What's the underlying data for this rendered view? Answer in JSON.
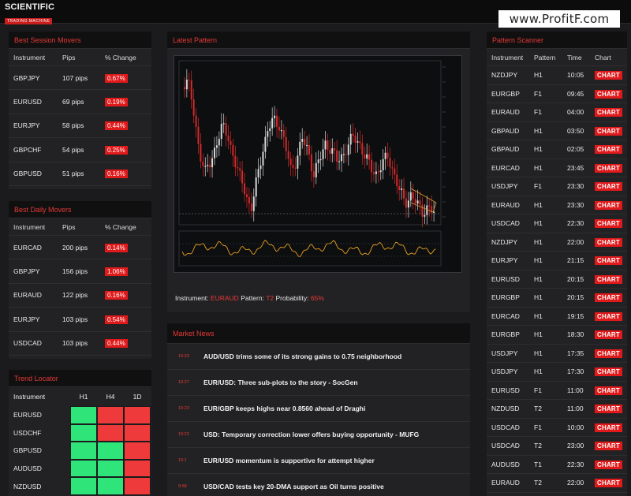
{
  "brand": {
    "line1": "SCIENTIFIC",
    "line2": "TRADING MACHINE"
  },
  "watermark": "www.ProfitF.com",
  "session_movers": {
    "title": "Best Session Movers",
    "headers": [
      "Instrument",
      "Pips",
      "% Change"
    ],
    "rows": [
      {
        "instrument": "GBPJPY",
        "pips": "107 pips",
        "change": "0.67%"
      },
      {
        "instrument": "EURUSD",
        "pips": "69 pips",
        "change": "0.19%"
      },
      {
        "instrument": "EURJPY",
        "pips": "58 pips",
        "change": "0.44%"
      },
      {
        "instrument": "GBPCHF",
        "pips": "54 pips",
        "change": "0.25%"
      },
      {
        "instrument": "GBPUSD",
        "pips": "51 pips",
        "change": "0.16%"
      }
    ]
  },
  "daily_movers": {
    "title": "Best Daily Movers",
    "headers": [
      "Instrument",
      "Pips",
      "% Change"
    ],
    "rows": [
      {
        "instrument": "EURCAD",
        "pips": "200 pips",
        "change": "0.14%"
      },
      {
        "instrument": "GBPJPY",
        "pips": "156 pips",
        "change": "1.06%"
      },
      {
        "instrument": "EURAUD",
        "pips": "122 pips",
        "change": "0.16%"
      },
      {
        "instrument": "EURJPY",
        "pips": "103 pips",
        "change": "0.54%"
      },
      {
        "instrument": "USDCAD",
        "pips": "103 pips",
        "change": "0.44%"
      }
    ]
  },
  "trend_locator": {
    "title": "Trend Locator",
    "headers": [
      "Instrument",
      "H1",
      "H4",
      "1D"
    ],
    "colors": {
      "green": "#2fe57a",
      "red": "#ee3a3a"
    },
    "rows": [
      {
        "instrument": "EURUSD",
        "h1": "green",
        "h4": "red",
        "d1": "red"
      },
      {
        "instrument": "USDCHF",
        "h1": "green",
        "h4": "red",
        "d1": "red"
      },
      {
        "instrument": "GBPUSD",
        "h1": "green",
        "h4": "green",
        "d1": "red"
      },
      {
        "instrument": "AUDUSD",
        "h1": "green",
        "h4": "green",
        "d1": "red"
      },
      {
        "instrument": "NZDUSD",
        "h1": "green",
        "h4": "green",
        "d1": "red"
      }
    ]
  },
  "latest_pattern": {
    "title": "Latest Pattern",
    "caption": {
      "instrument_label": "Instrument:",
      "instrument": "EURAUD",
      "pattern_label": "Pattern:",
      "pattern": "T2",
      "probability_label": "Probability:",
      "probability": "65%"
    }
  },
  "market_news": {
    "title": "Market News",
    "items": [
      {
        "time": "10:33",
        "title": "AUD/USD trims some of its strong gains to 0.75 neighborhood"
      },
      {
        "time": "10:27",
        "title": "EUR/USD: Three sub-plots to the story - SocGen"
      },
      {
        "time": "10:23",
        "title": "EUR/GBP keeps highs near 0.8560 ahead of Draghi"
      },
      {
        "time": "10:22",
        "title": "USD: Temporary correction lower offers buying opportunity - MUFG"
      },
      {
        "time": "10:1",
        "title": "EUR/USD momentum is supportive for attempt higher"
      },
      {
        "time": "9:58",
        "title": "USD/CAD tests key 20-DMA support as Oil turns positive"
      }
    ]
  },
  "pattern_scanner": {
    "title": "Pattern Scanner",
    "headers": [
      "Instrument",
      "Pattern",
      "Time",
      "Chart"
    ],
    "button_label": "CHART",
    "rows": [
      {
        "instrument": "NZDJPY",
        "pattern": "H1",
        "time": "10:05"
      },
      {
        "instrument": "EURGBP",
        "pattern": "F1",
        "time": "09:45"
      },
      {
        "instrument": "EURAUD",
        "pattern": "F1",
        "time": "04:00"
      },
      {
        "instrument": "GBPAUD",
        "pattern": "H1",
        "time": "03:50"
      },
      {
        "instrument": "GBPAUD",
        "pattern": "H1",
        "time": "02:05"
      },
      {
        "instrument": "EURCAD",
        "pattern": "H1",
        "time": "23:45"
      },
      {
        "instrument": "USDJPY",
        "pattern": "F1",
        "time": "23:30"
      },
      {
        "instrument": "EURAUD",
        "pattern": "H1",
        "time": "23:30"
      },
      {
        "instrument": "USDCAD",
        "pattern": "H1",
        "time": "22:30"
      },
      {
        "instrument": "NZDJPY",
        "pattern": "H1",
        "time": "22:00"
      },
      {
        "instrument": "EURJPY",
        "pattern": "H1",
        "time": "21:15"
      },
      {
        "instrument": "EURUSD",
        "pattern": "H1",
        "time": "20:15"
      },
      {
        "instrument": "EURGBP",
        "pattern": "H1",
        "time": "20:15"
      },
      {
        "instrument": "EURCAD",
        "pattern": "H1",
        "time": "19:15"
      },
      {
        "instrument": "EURGBP",
        "pattern": "H1",
        "time": "18:30"
      },
      {
        "instrument": "USDJPY",
        "pattern": "H1",
        "time": "17:35"
      },
      {
        "instrument": "USDJPY",
        "pattern": "H1",
        "time": "17:30"
      },
      {
        "instrument": "EURUSD",
        "pattern": "F1",
        "time": "11:00"
      },
      {
        "instrument": "NZDUSD",
        "pattern": "T2",
        "time": "11:00"
      },
      {
        "instrument": "USDCAD",
        "pattern": "F1",
        "time": "10:00"
      },
      {
        "instrument": "USDCAD",
        "pattern": "T2",
        "time": "23:00"
      },
      {
        "instrument": "AUDUSD",
        "pattern": "T1",
        "time": "22:30"
      },
      {
        "instrument": "EURAUD",
        "pattern": "T2",
        "time": "22:00"
      }
    ]
  }
}
